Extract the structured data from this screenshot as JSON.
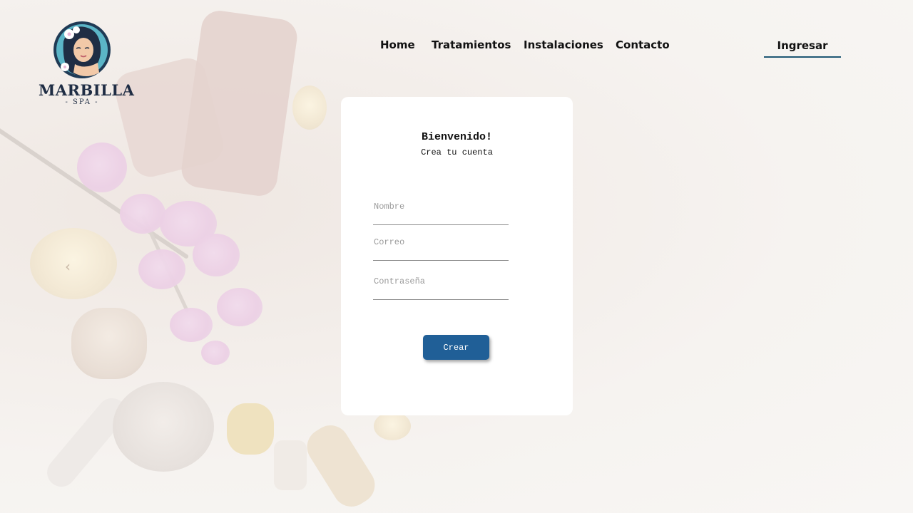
{
  "brand": {
    "name": "MARBILLA",
    "tagline": "SPA"
  },
  "nav": {
    "items": [
      "Home",
      "Tratamientos",
      "Instalaciones",
      "Contacto"
    ],
    "login_label": "Ingresar"
  },
  "form": {
    "title": "Bienvenido!",
    "subtitle": "Crea tu cuenta",
    "fields": {
      "name_placeholder": "Nombre",
      "email_placeholder": "Correo",
      "password_placeholder": "Contraseña"
    },
    "submit_label": "Crear"
  },
  "carousel": {
    "prev_icon": "chevron-left-icon",
    "prev_glyph": "‹"
  },
  "colors": {
    "accent": "#205f97",
    "login_underline": "#1e5874",
    "brand_text": "#1f2d44"
  }
}
